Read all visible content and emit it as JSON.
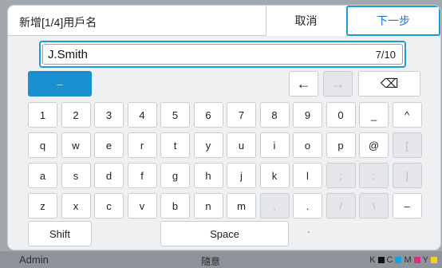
{
  "dialog": {
    "title": "新增[1/4]用戶名",
    "cancel_label": "取消",
    "next_label": "下一步"
  },
  "input": {
    "value": "J.Smith",
    "counter": "7/10"
  },
  "keyboard": {
    "mode_label": "–",
    "nav": {
      "left": "←",
      "right": "→",
      "backspace": "⌫"
    },
    "row1": [
      "1",
      "2",
      "3",
      "4",
      "5",
      "6",
      "7",
      "8",
      "9",
      "0",
      "_",
      "^"
    ],
    "row2": [
      "q",
      "w",
      "e",
      "r",
      "t",
      "y",
      "u",
      "i",
      "o",
      "p",
      "@",
      "["
    ],
    "row3": [
      "a",
      "s",
      "d",
      "f",
      "g",
      "h",
      "j",
      "k",
      "l",
      ";",
      ":",
      "]"
    ],
    "row4": [
      "z",
      "x",
      "c",
      "v",
      "b",
      "n",
      "m",
      ",",
      ".",
      "/",
      "\\",
      "–"
    ],
    "shift_label": "Shift",
    "space_label": "Space",
    "extra_dot": "·"
  },
  "background": {
    "user": "Admin",
    "center_text": "隨意",
    "legend": [
      "K",
      "C",
      "M",
      "Y"
    ],
    "legend_colors": [
      "#111111",
      "#12a3e0",
      "#d6307f",
      "#f2d21b"
    ]
  }
}
